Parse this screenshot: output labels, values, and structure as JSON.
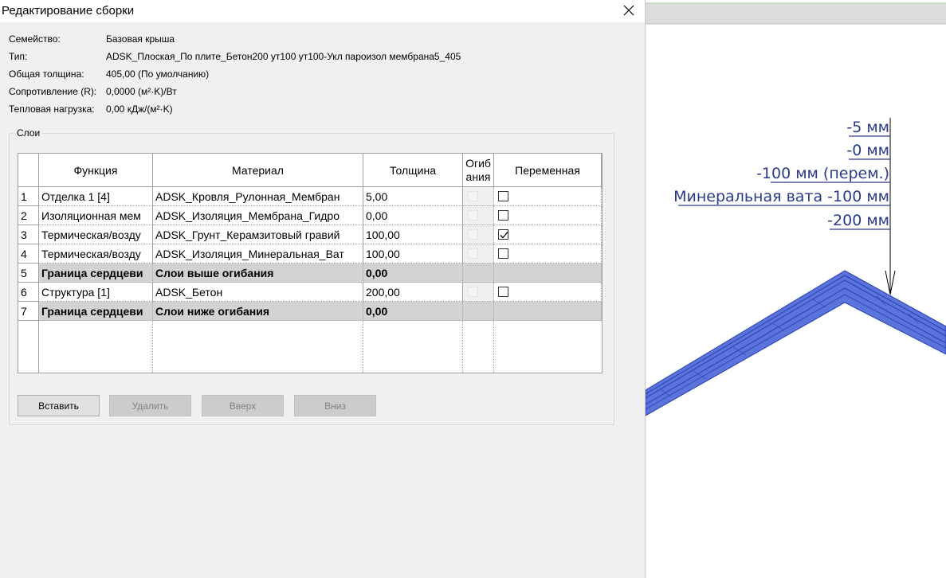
{
  "window": {
    "title": "Редактирование сборки",
    "close_icon": "close-icon"
  },
  "properties": [
    {
      "label": "Семейство:",
      "value": "Базовая крыша"
    },
    {
      "label": "Тип:",
      "value": "ADSK_Плоская_По плите_Бетон200 ут100 ут100-Укл пароизол мембрана5_405"
    },
    {
      "label": "Общая толщина:",
      "value": "405,00 (По умолчанию)"
    },
    {
      "label": "Сопротивление (R):",
      "value": "0,0000 (м²·K)/Вт"
    },
    {
      "label": "Тепловая нагрузка:",
      "value": "0,00 кДж/(м²·K)"
    }
  ],
  "layers": {
    "group_label": "Слои",
    "headers": {
      "function": "Функция",
      "material": "Материал",
      "thickness": "Толщина",
      "wraps_line1": "Огиб",
      "wraps_line2": "ания",
      "variable": "Переменная"
    },
    "rows": [
      {
        "num": "1",
        "function": "Отделка 1 [4]",
        "material": "ADSK_Кровля_Рулонная_Мембран",
        "thickness": "5,00",
        "core": false,
        "wraps": false,
        "variable": false,
        "has_checkboxes": true
      },
      {
        "num": "2",
        "function": "Изоляционная мем",
        "material": "ADSK_Изоляция_Мембрана_Гидро",
        "thickness": "0,00",
        "core": false,
        "wraps": false,
        "variable": false,
        "has_checkboxes": true
      },
      {
        "num": "3",
        "function": "Термическая/возду",
        "material": "ADSK_Грунт_Керамзитовый гравий",
        "thickness": "100,00",
        "core": false,
        "wraps": false,
        "variable": true,
        "has_checkboxes": true
      },
      {
        "num": "4",
        "function": "Термическая/возду",
        "material": "ADSK_Изоляция_Минеральная_Ват",
        "thickness": "100,00",
        "core": false,
        "wraps": false,
        "variable": false,
        "has_checkboxes": true
      },
      {
        "num": "5",
        "function": "Граница сердцеви",
        "material": "Слои выше огибания",
        "thickness": "0,00",
        "core": true,
        "has_checkboxes": false
      },
      {
        "num": "6",
        "function": "Структура [1]",
        "material": "ADSK_Бетон",
        "thickness": "200,00",
        "core": false,
        "wraps": false,
        "variable": false,
        "has_checkboxes": true
      },
      {
        "num": "7",
        "function": "Граница сердцеви",
        "material": "Слои ниже огибания",
        "thickness": "0,00",
        "core": true,
        "has_checkboxes": false
      }
    ]
  },
  "buttons": {
    "insert": "Вставить",
    "delete": "Удалить",
    "up": "Вверх",
    "down": "Вниз"
  },
  "drawing": {
    "annotations": [
      "-5 мм",
      "-0 мм",
      "-100 мм (перем.)",
      "Минеральная вата -100 мм",
      "-200 мм"
    ],
    "colors": {
      "roof_fill": "#5b74dc",
      "roof_edge": "#2740b0",
      "annotation": "#2b3b8c",
      "header_strip": "#dcdcdc"
    }
  }
}
